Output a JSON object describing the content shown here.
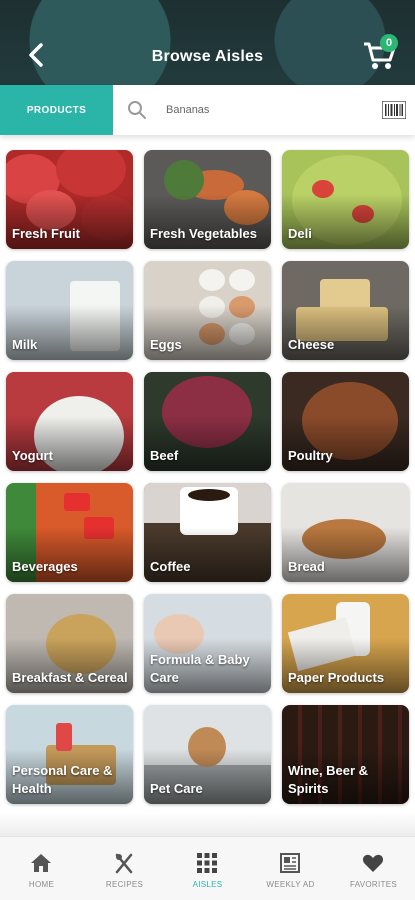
{
  "header": {
    "title": "Browse Aisles",
    "cart_count": "0"
  },
  "search": {
    "tab_label": "PRODUCTS",
    "placeholder": "Bananas"
  },
  "aisles": [
    {
      "label": "Fresh Fruit"
    },
    {
      "label": "Fresh Vegetables"
    },
    {
      "label": "Deli"
    },
    {
      "label": "Milk"
    },
    {
      "label": "Eggs"
    },
    {
      "label": "Cheese"
    },
    {
      "label": "Yogurt"
    },
    {
      "label": "Beef"
    },
    {
      "label": "Poultry"
    },
    {
      "label": "Beverages"
    },
    {
      "label": "Coffee"
    },
    {
      "label": "Bread"
    },
    {
      "label": "Breakfast & Cereal"
    },
    {
      "label": "Formula & Baby Care"
    },
    {
      "label": "Paper Products"
    },
    {
      "label": "Personal Care & Health"
    },
    {
      "label": "Pet Care"
    },
    {
      "label": "Wine, Beer & Spirits"
    }
  ],
  "nav": [
    {
      "label": "HOME",
      "icon": "home-icon"
    },
    {
      "label": "RECIPES",
      "icon": "fork-knife-icon"
    },
    {
      "label": "AISLES",
      "icon": "grid-icon",
      "active": true
    },
    {
      "label": "WEEKLY AD",
      "icon": "newspaper-icon"
    },
    {
      "label": "FAVORITES",
      "icon": "heart-icon"
    }
  ],
  "colors": {
    "accent": "#2bb5a9",
    "badge": "#2bb673"
  }
}
